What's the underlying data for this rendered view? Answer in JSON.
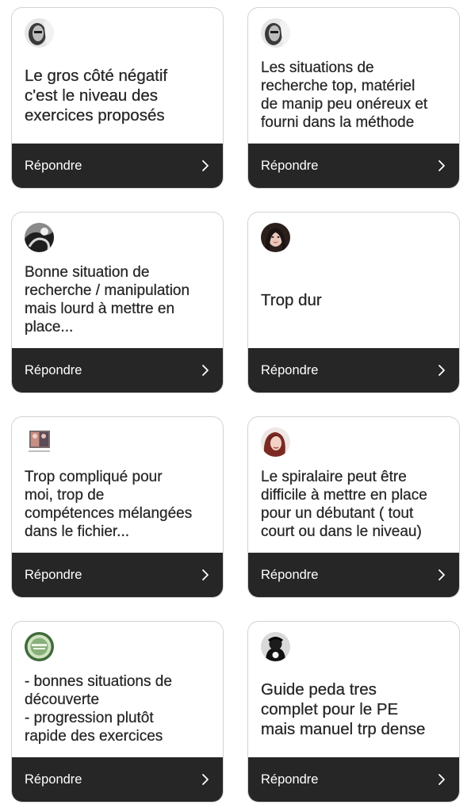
{
  "reply_label": "Répondre",
  "cards": [
    {
      "text": "Le gros côté négatif\nc'est le niveau des\nexercices proposés",
      "avatar": "bw-portrait"
    },
    {
      "text": "Les situations de\nrecherche top, matériel\nde manip peu onéreux et\nfourni dans la méthode",
      "avatar": "bw-portrait"
    },
    {
      "text": "Bonne situation de\nrecherche / manipulation\nmais lourd à mettre en\nplace...",
      "avatar": "bw-abstract"
    },
    {
      "text": "Trop dur",
      "avatar": "dark-hair-portrait"
    },
    {
      "text": "Trop compliqué pour\nmoi, trop de\ncompétences mélangées\ndans le fichier...",
      "avatar": "small-photo"
    },
    {
      "text": "Le spiralaire peut être\ndifficile à mettre en place\npour un débutant ( tout\ncourt ou dans le niveau)",
      "avatar": "red-hair-portrait"
    },
    {
      "text": "- bonnes situations de\ndécouverte\n- progression plutôt\nrapide des exercices",
      "avatar": "green-badge"
    },
    {
      "text": "Guide peda tres\ncomplet pour le PE\nmais manuel trp dense",
      "avatar": "black-character"
    }
  ],
  "colors": {
    "bar_background": "#262626",
    "card_border": "#d3d3d3",
    "text": "#262626"
  }
}
